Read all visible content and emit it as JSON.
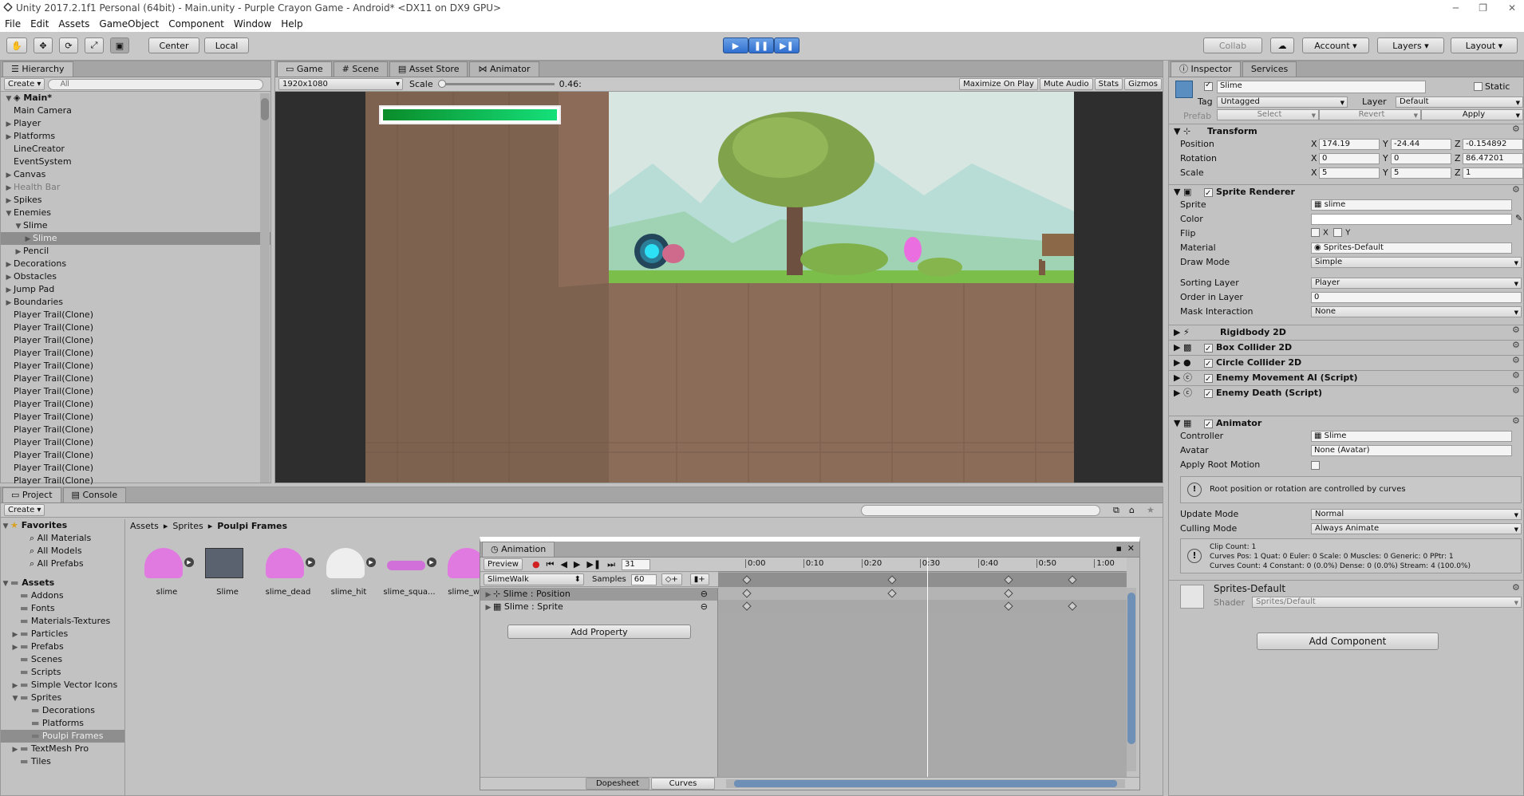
{
  "window": {
    "title": "Unity 2017.2.1f1 Personal (64bit) - Main.unity - Purple Crayon Game - Android* <DX11 on DX9 GPU>"
  },
  "menu": [
    "File",
    "Edit",
    "Assets",
    "GameObject",
    "Component",
    "Window",
    "Help"
  ],
  "toolbar": {
    "pivot": "Center",
    "space": "Local",
    "collab": "Collab",
    "account": "Account",
    "layers": "Layers",
    "layout": "Layout"
  },
  "hierarchy": {
    "tab": "Hierarchy",
    "create": "Create",
    "search_placeholder": "All",
    "scene": "Main*",
    "items": [
      {
        "label": "Main Camera",
        "indent": 1,
        "arrow": false,
        "dim": false
      },
      {
        "label": "Player",
        "indent": 1,
        "arrow": true,
        "dim": false
      },
      {
        "label": "Platforms",
        "indent": 1,
        "arrow": true,
        "dim": false
      },
      {
        "label": "LineCreator",
        "indent": 1,
        "arrow": false,
        "dim": false
      },
      {
        "label": "EventSystem",
        "indent": 1,
        "arrow": false,
        "dim": false
      },
      {
        "label": "Canvas",
        "indent": 1,
        "arrow": true,
        "dim": false
      },
      {
        "label": "Health Bar",
        "indent": 1,
        "arrow": true,
        "dim": true
      },
      {
        "label": "Spikes",
        "indent": 1,
        "arrow": true,
        "dim": false
      },
      {
        "label": "Enemies",
        "indent": 1,
        "arrow": "open",
        "dim": false
      },
      {
        "label": "Slime",
        "indent": 2,
        "arrow": "open",
        "dim": false
      },
      {
        "label": "Slime",
        "indent": 3,
        "arrow": true,
        "dim": false,
        "sel": true
      },
      {
        "label": "Pencil",
        "indent": 2,
        "arrow": true,
        "dim": false
      },
      {
        "label": "Decorations",
        "indent": 1,
        "arrow": true,
        "dim": false
      },
      {
        "label": "Obstacles",
        "indent": 1,
        "arrow": true,
        "dim": false
      },
      {
        "label": "Jump Pad",
        "indent": 1,
        "arrow": true,
        "dim": false
      },
      {
        "label": "Boundaries",
        "indent": 1,
        "arrow": true,
        "dim": false
      },
      {
        "label": "Player Trail(Clone)",
        "indent": 1,
        "arrow": false,
        "dim": false
      },
      {
        "label": "Player Trail(Clone)",
        "indent": 1,
        "arrow": false,
        "dim": false
      },
      {
        "label": "Player Trail(Clone)",
        "indent": 1,
        "arrow": false,
        "dim": false
      },
      {
        "label": "Player Trail(Clone)",
        "indent": 1,
        "arrow": false,
        "dim": false
      },
      {
        "label": "Player Trail(Clone)",
        "indent": 1,
        "arrow": false,
        "dim": false
      },
      {
        "label": "Player Trail(Clone)",
        "indent": 1,
        "arrow": false,
        "dim": false
      },
      {
        "label": "Player Trail(Clone)",
        "indent": 1,
        "arrow": false,
        "dim": false
      },
      {
        "label": "Player Trail(Clone)",
        "indent": 1,
        "arrow": false,
        "dim": false
      },
      {
        "label": "Player Trail(Clone)",
        "indent": 1,
        "arrow": false,
        "dim": false
      },
      {
        "label": "Player Trail(Clone)",
        "indent": 1,
        "arrow": false,
        "dim": false
      },
      {
        "label": "Player Trail(Clone)",
        "indent": 1,
        "arrow": false,
        "dim": false
      },
      {
        "label": "Player Trail(Clone)",
        "indent": 1,
        "arrow": false,
        "dim": false
      },
      {
        "label": "Player Trail(Clone)",
        "indent": 1,
        "arrow": false,
        "dim": false
      },
      {
        "label": "Player Trail(Clone)",
        "indent": 1,
        "arrow": false,
        "dim": false
      }
    ]
  },
  "game": {
    "tabs": [
      "Game",
      "Scene",
      "Asset Store",
      "Animator"
    ],
    "resolution": "1920x1080",
    "scale_label": "Scale",
    "scale_value": "0.46:",
    "options": [
      "Maximize On Play",
      "Mute Audio",
      "Stats",
      "Gizmos"
    ],
    "health": 1.0
  },
  "project": {
    "tabs": [
      "Project",
      "Console"
    ],
    "create": "Create",
    "breadcrumb": [
      "Assets",
      "Sprites",
      "Poulpi Frames"
    ],
    "favorites_label": "Favorites",
    "favorites": [
      "All Materials",
      "All Models",
      "All Prefabs"
    ],
    "assets_label": "Assets",
    "folders": [
      {
        "label": "Addons",
        "indent": 1,
        "arrow": false
      },
      {
        "label": "Fonts",
        "indent": 1,
        "arrow": false
      },
      {
        "label": "Materials-Textures",
        "indent": 1,
        "arrow": false
      },
      {
        "label": "Particles",
        "indent": 1,
        "arrow": true
      },
      {
        "label": "Prefabs",
        "indent": 1,
        "arrow": true
      },
      {
        "label": "Scenes",
        "indent": 1,
        "arrow": false
      },
      {
        "label": "Scripts",
        "indent": 1,
        "arrow": false
      },
      {
        "label": "Simple Vector Icons",
        "indent": 1,
        "arrow": true
      },
      {
        "label": "Sprites",
        "indent": 1,
        "arrow": "open"
      },
      {
        "label": "Decorations",
        "indent": 2,
        "arrow": false
      },
      {
        "label": "Platforms",
        "indent": 2,
        "arrow": false
      },
      {
        "label": "Poulpi Frames",
        "indent": 2,
        "arrow": false,
        "sel": true
      },
      {
        "label": "TextMesh Pro",
        "indent": 1,
        "arrow": true
      },
      {
        "label": "Tiles",
        "indent": 1,
        "arrow": false
      }
    ],
    "assets": [
      "slime",
      "Slime",
      "slime_dead",
      "slime_hit",
      "slime_squa...",
      "slime_wa..."
    ]
  },
  "animation": {
    "title": "Animation",
    "preview": "Preview",
    "frame": "31",
    "clip": "SlimeWalk",
    "samples_label": "Samples",
    "samples": "60",
    "times": [
      "0:00",
      "0:10",
      "0:20",
      "0:30",
      "0:40",
      "0:50",
      "1:00"
    ],
    "properties": [
      "Slime : Position",
      "Slime : Sprite"
    ],
    "add_property": "Add Property",
    "dopesheet": "Dopesheet",
    "curves": "Curves",
    "key_times": [
      0,
      25,
      45,
      56
    ],
    "sprite_key_times": [
      0,
      45,
      56
    ],
    "playhead_time": 31,
    "timeline_end": 62
  },
  "inspector": {
    "tabs": [
      "Inspector",
      "Services"
    ],
    "name": "Slime",
    "static": "Static",
    "tag_label": "Tag",
    "tag": "Untagged",
    "layer_label": "Layer",
    "layer": "Default",
    "prefab_label": "Prefab",
    "prefab_buttons": [
      "Select",
      "Revert",
      "Apply"
    ],
    "transform": {
      "title": "Transform",
      "position_label": "Position",
      "rotation_label": "Rotation",
      "scale_label": "Scale",
      "position": [
        "174.19",
        "-24.44",
        "-0.154892"
      ],
      "rotation": [
        "0",
        "0",
        "86.47201"
      ],
      "scale": [
        "5",
        "5",
        "1"
      ]
    },
    "sprite_renderer": {
      "title": "Sprite Renderer",
      "sprite_label": "Sprite",
      "sprite": "slime",
      "color_label": "Color",
      "flip_label": "Flip",
      "flip_x": "X",
      "flip_y": "Y",
      "material_label": "Material",
      "material": "Sprites-Default",
      "draw_mode_label": "Draw Mode",
      "draw_mode": "Simple",
      "sorting_layer_label": "Sorting Layer",
      "sorting_layer": "Player",
      "order_label": "Order in Layer",
      "order": "0",
      "mask_label": "Mask Interaction",
      "mask": "None"
    },
    "components": [
      "Rigidbody 2D",
      "Box Collider 2D",
      "Circle Collider 2D",
      "Enemy Movement AI (Script)",
      "Enemy Death (Script)"
    ],
    "animator": {
      "title": "Animator",
      "controller_label": "Controller",
      "controller": "Slime",
      "avatar_label": "Avatar",
      "avatar": "None (Avatar)",
      "root_motion_label": "Apply Root Motion",
      "root_info": "Root position or rotation are controlled by curves",
      "update_label": "Update Mode",
      "update": "Normal",
      "culling_label": "Culling Mode",
      "culling": "Always Animate",
      "clip_info": [
        "Clip Count: 1",
        "Curves Pos: 1 Quat: 0 Euler: 0 Scale: 0 Muscles: 0 Generic: 0 PPtr: 1",
        "Curves Count: 4 Constant: 0 (0.0%) Dense: 0 (0.0%) Stream: 4 (100.0%)"
      ]
    },
    "material_name": "Sprites-Default",
    "shader_label": "Shader",
    "shader": "Sprites/Default",
    "add_component": "Add Component"
  }
}
